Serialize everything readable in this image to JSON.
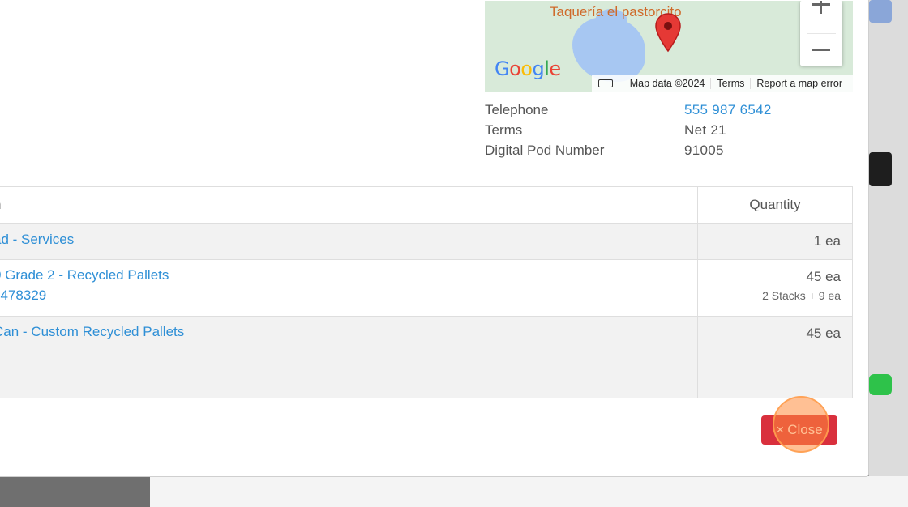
{
  "map": {
    "place_label": "Taquería el pastorcito",
    "logo_text": [
      "G",
      "o",
      "o",
      "g",
      "l",
      "e"
    ],
    "footer": {
      "attribution": "Map data ©2024",
      "terms": "Terms",
      "report": "Report a map error"
    },
    "zoom_in": "+",
    "zoom_out": "−"
  },
  "info": {
    "rows": [
      {
        "label": "Telephone",
        "value": "555 987 6542",
        "is_link": true
      },
      {
        "label": "Terms",
        "value": "Net 21",
        "is_link": false
      },
      {
        "label": "Digital Pod Number",
        "value": "91005",
        "is_link": false
      }
    ]
  },
  "table": {
    "headers": {
      "item": "n",
      "quantity": "Quantity"
    },
    "rows": [
      {
        "lines": [
          "ad - Services"
        ],
        "qty": "1 ea",
        "qty_sub": ""
      },
      {
        "lines": [
          "0 Grade 2 - Recycled Pallets",
          "J478329"
        ],
        "qty": "45 ea",
        "qty_sub": "2 Stacks + 9 ea"
      },
      {
        "lines": [
          "Can - Custom Recycled Pallets"
        ],
        "qty": "45 ea",
        "qty_sub": ""
      }
    ]
  },
  "footer": {
    "close_icon": "×",
    "close_label": "Close"
  },
  "colors": {
    "link": "#2e8fd6",
    "close_button": "#d9303d",
    "map_pin": "#e53935"
  }
}
